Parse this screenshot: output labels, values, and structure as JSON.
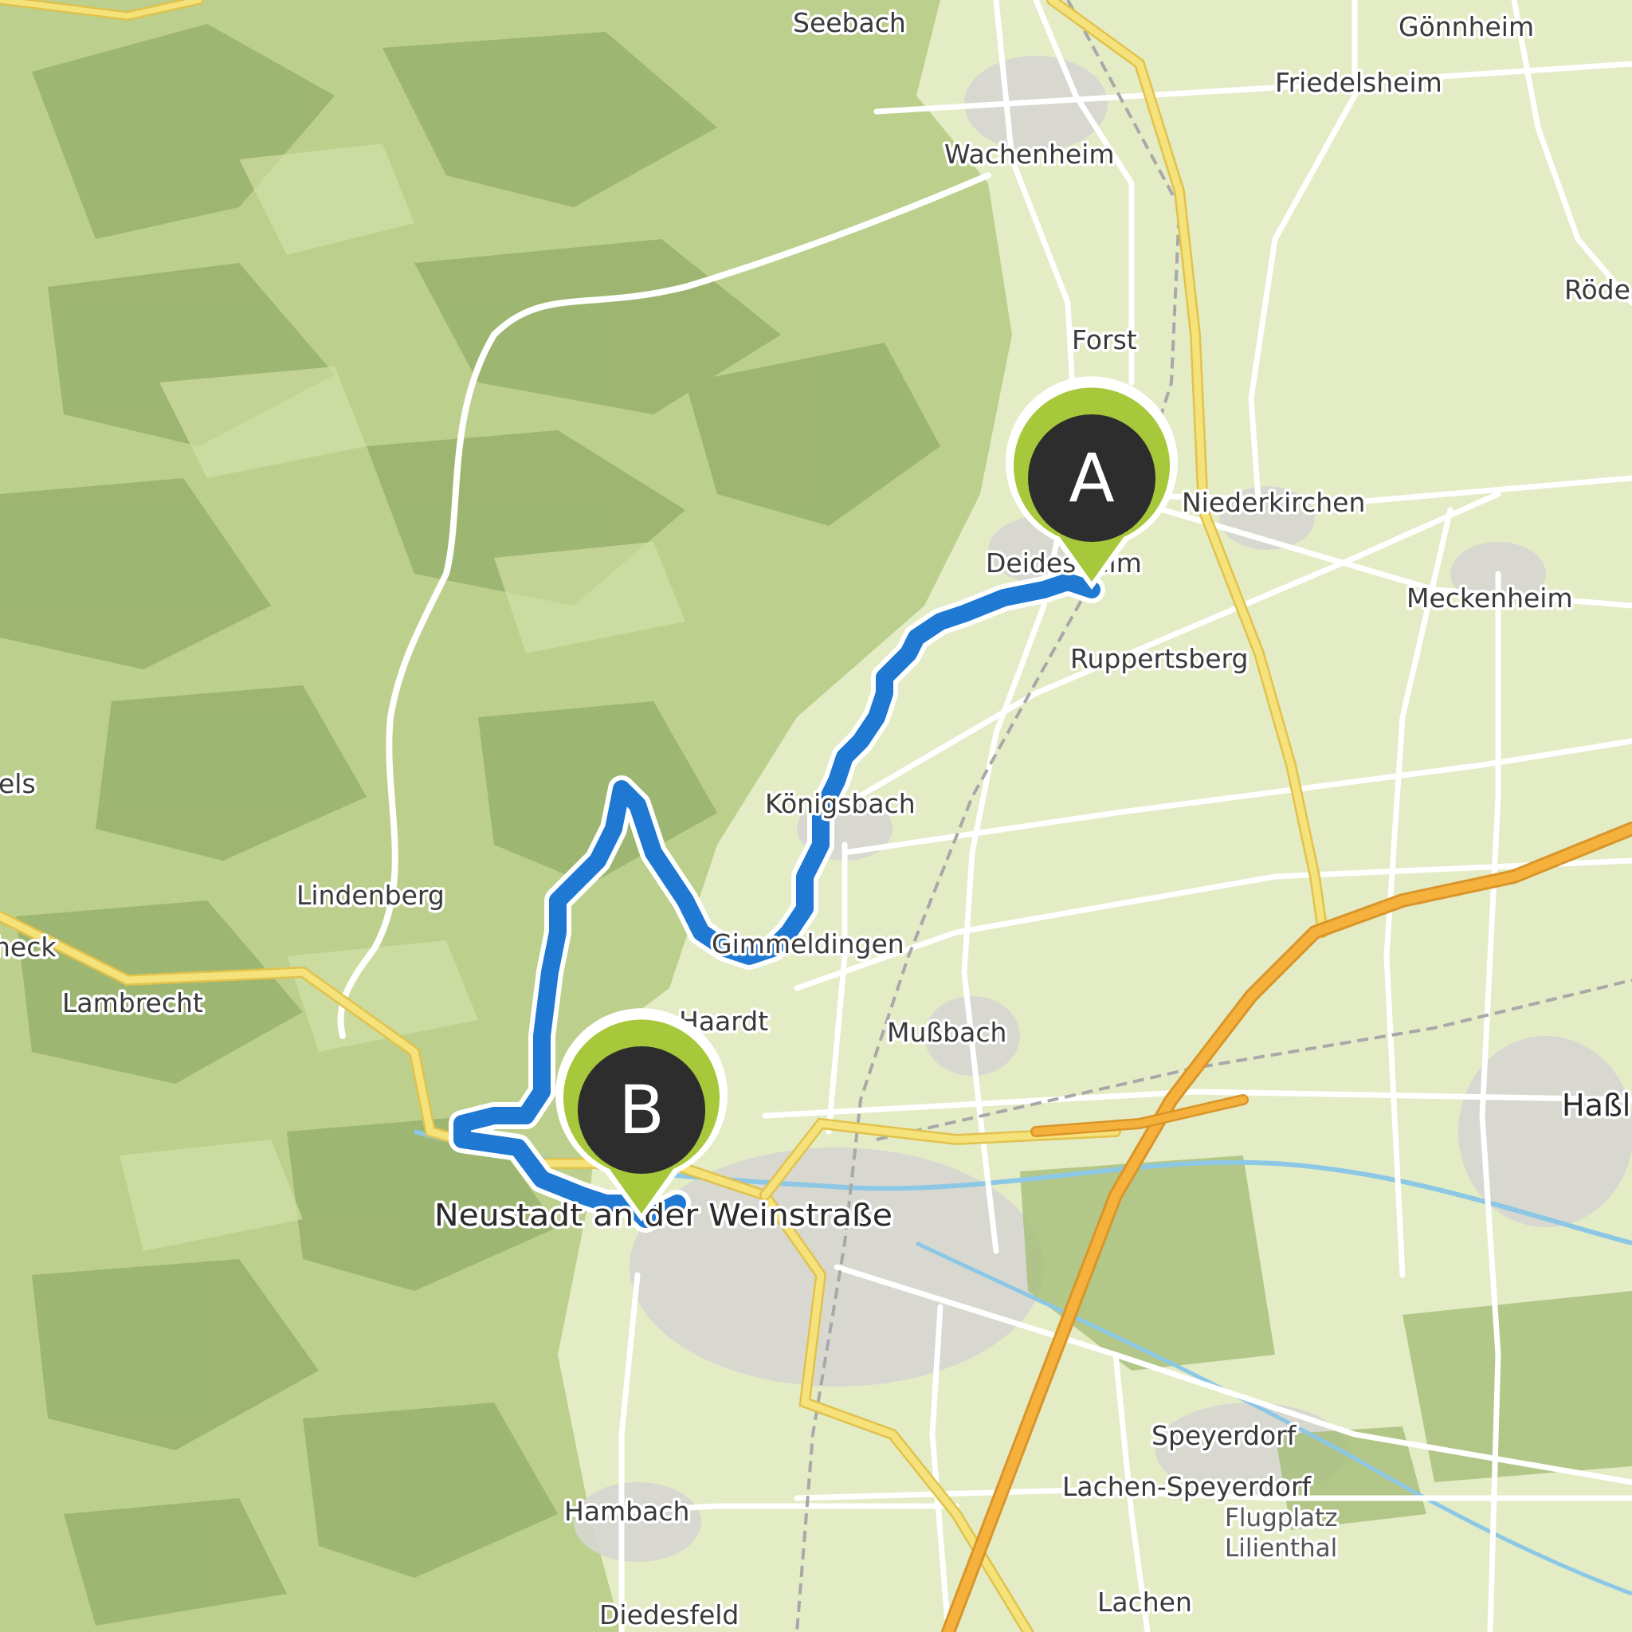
{
  "map": {
    "colors": {
      "forest_light": "#c9d99a",
      "forest_mid": "#a9bf7a",
      "forest_dark": "#7f9858",
      "plain": "#e4ecc6",
      "urban": "#d4d4d4",
      "road_primary": "#f3dd6a",
      "motorway": "#f5b13b",
      "road_minor": "#ffffff",
      "river": "#8cc7e6",
      "route": "#1f78d1",
      "marker_green": "#a6c83a",
      "marker_dark": "#2d2d2d"
    },
    "places": [
      {
        "id": "seebach",
        "label": "Seebach",
        "size": "mid"
      },
      {
        "id": "goennheim",
        "label": "Gönnheim",
        "size": "mid"
      },
      {
        "id": "friedelsheim",
        "label": "Friedelsheim",
        "size": "mid"
      },
      {
        "id": "wachenheim",
        "label": "Wachenheim",
        "size": "mid"
      },
      {
        "id": "roedersheim",
        "label": "Röde",
        "size": "mid"
      },
      {
        "id": "forst",
        "label": "Forst",
        "size": "mid"
      },
      {
        "id": "niederkirchen",
        "label": "Niederkirchen",
        "size": "mid"
      },
      {
        "id": "deidesheim",
        "label": "Deidesheim",
        "size": "mid"
      },
      {
        "id": "meckenheim",
        "label": "Meckenheim",
        "size": "mid"
      },
      {
        "id": "ruppertsberg",
        "label": "Ruppertsberg",
        "size": "mid"
      },
      {
        "id": "koenigsbach",
        "label": "Königsbach",
        "size": "mid"
      },
      {
        "id": "els",
        "label": "els",
        "size": "mid"
      },
      {
        "id": "lindenberg",
        "label": "Lindenberg",
        "size": "mid"
      },
      {
        "id": "gimmeldingen",
        "label": "Gimmeldingen",
        "size": "mid"
      },
      {
        "id": "heck",
        "label": "heck",
        "size": "mid"
      },
      {
        "id": "lambrecht",
        "label": "Lambrecht",
        "size": "mid"
      },
      {
        "id": "haardt",
        "label": "Haardt",
        "size": "mid"
      },
      {
        "id": "mussbach",
        "label": "Mußbach",
        "size": "mid"
      },
      {
        "id": "hassloch",
        "label": "Haßl",
        "size": "big"
      },
      {
        "id": "neustadt",
        "label": "Neustadt an der Weinstraße",
        "size": "big"
      },
      {
        "id": "speyerdorf",
        "label": "Speyerdorf",
        "size": "mid"
      },
      {
        "id": "lachen_speyerdorf",
        "label": "Lachen-Speyerdorf",
        "size": "mid"
      },
      {
        "id": "flugplatz",
        "label": "Flugplatz",
        "size": "small"
      },
      {
        "id": "lilienthal",
        "label": "Lilienthal",
        "size": "small"
      },
      {
        "id": "hambach",
        "label": "Hambach",
        "size": "mid"
      },
      {
        "id": "lachen",
        "label": "Lachen",
        "size": "mid"
      },
      {
        "id": "diedesfeld",
        "label": "Diedesfeld",
        "size": "mid"
      }
    ],
    "markers": {
      "start": {
        "letter": "A",
        "place": "Deidesheim"
      },
      "end": {
        "letter": "B",
        "place": "Neustadt an der Weinstraße"
      }
    }
  }
}
